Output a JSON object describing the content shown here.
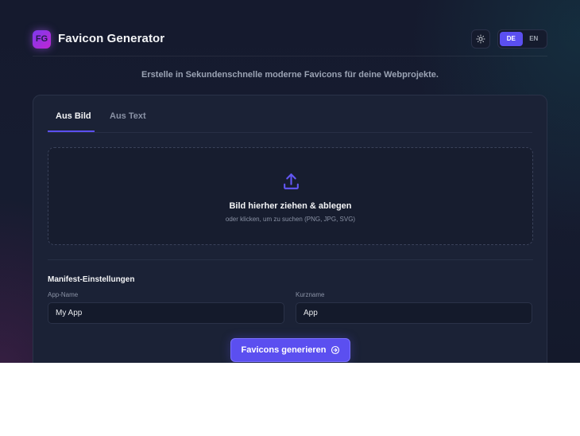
{
  "header": {
    "logo_text": "FG",
    "title": "Favicon Generator",
    "theme_icon": "sun-icon",
    "languages": [
      {
        "code": "DE",
        "active": true
      },
      {
        "code": "EN",
        "active": false
      }
    ]
  },
  "subtitle": "Erstelle in Sekundenschnelle moderne Favicons für deine Webprojekte.",
  "tabs": [
    {
      "label": "Aus Bild",
      "active": true
    },
    {
      "label": "Aus Text",
      "active": false
    }
  ],
  "dropzone": {
    "icon": "upload-icon",
    "title": "Bild hierher ziehen & ablegen",
    "hint": "oder klicken, um zu suchen (PNG, JPG, SVG)"
  },
  "manifest": {
    "title": "Manifest-Einstellungen",
    "app_name": {
      "label": "App-Name",
      "value": "My App"
    },
    "short_name": {
      "label": "Kurzname",
      "value": "App"
    }
  },
  "generate_button": {
    "label": "Favicons generieren",
    "icon": "arrow-circle-right-icon"
  },
  "colors": {
    "accent": "#5b4ff0",
    "background": "#161c30",
    "card": "#1b2236",
    "text": "#f3f4f6",
    "muted": "#8a92a5"
  }
}
